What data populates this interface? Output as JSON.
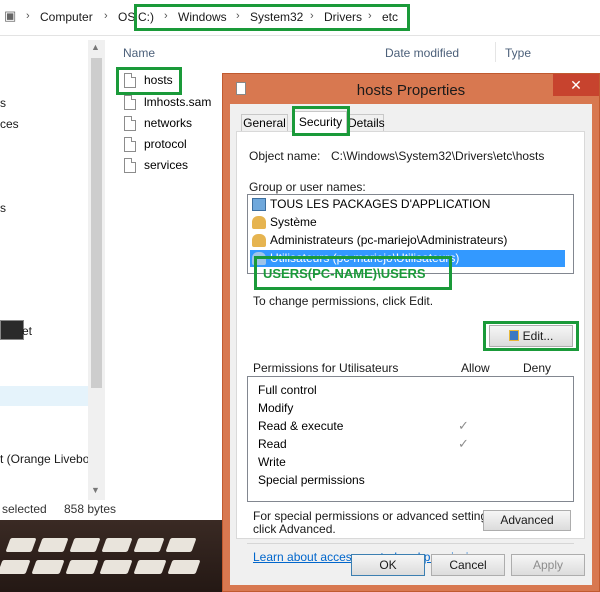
{
  "explorer": {
    "breadcrumbs": [
      "Computer",
      "OS",
      "C:)",
      "Windows",
      "System32",
      "Drivers",
      "etc"
    ],
    "columns": [
      "Name",
      "Date modified",
      "Type"
    ],
    "files": [
      "hosts",
      "lmhosts.sam",
      "networks",
      "protocol",
      "services"
    ],
    "left_fragments": [
      "s",
      "ces",
      "s",
      "et",
      "t (Orange Livebo"
    ],
    "status": {
      "selected": "selected",
      "size": "858 bytes"
    }
  },
  "dialog": {
    "title": "hosts Properties",
    "close_glyph": "✕",
    "tabs": [
      "General",
      "Security",
      "Details"
    ],
    "object_name_label": "Object name:",
    "object_name_value": "C:\\Windows\\System32\\Drivers\\etc\\hosts",
    "group_label": "Group or user names:",
    "groups": [
      {
        "name": "TOUS LES PACKAGES D'APPLICATION",
        "icon": "app-packages-icon",
        "selected": false
      },
      {
        "name": "Système",
        "icon": "users-group-icon",
        "selected": false
      },
      {
        "name": "Administrateurs (pc-mariejo\\Administrateurs)",
        "icon": "users-group-icon",
        "selected": false
      },
      {
        "name": "Utilisateurs (pc-mariejo\\Utilisateurs)",
        "icon": "users-group-icon",
        "selected": true
      }
    ],
    "annotation": "USERS(PC-NAME)\\USERS",
    "change_hint": "To change permissions, click Edit.",
    "edit_button": "Edit...",
    "permissions_label": "Permissions for Utilisateurs",
    "allow_header": "Allow",
    "deny_header": "Deny",
    "permissions": [
      {
        "name": "Full control",
        "allow": "",
        "deny": ""
      },
      {
        "name": "Modify",
        "allow": "",
        "deny": ""
      },
      {
        "name": "Read & execute",
        "allow": "✓",
        "deny": ""
      },
      {
        "name": "Read",
        "allow": "✓",
        "deny": ""
      },
      {
        "name": "Write",
        "allow": "",
        "deny": ""
      },
      {
        "name": "Special permissions",
        "allow": "",
        "deny": ""
      }
    ],
    "advanced_hint_1": "For special permissions or advanced settings,",
    "advanced_hint_2": "click Advanced.",
    "advanced_button": "Advanced",
    "learn_link": "Learn about access control and permissions",
    "ok_button": "OK",
    "cancel_button": "Cancel",
    "apply_button": "Apply"
  },
  "colors": {
    "highlight_green": "#1a9a39",
    "selection_blue": "#3399ff",
    "dialog_frame": "#d87850",
    "link_blue": "#0066cc"
  }
}
